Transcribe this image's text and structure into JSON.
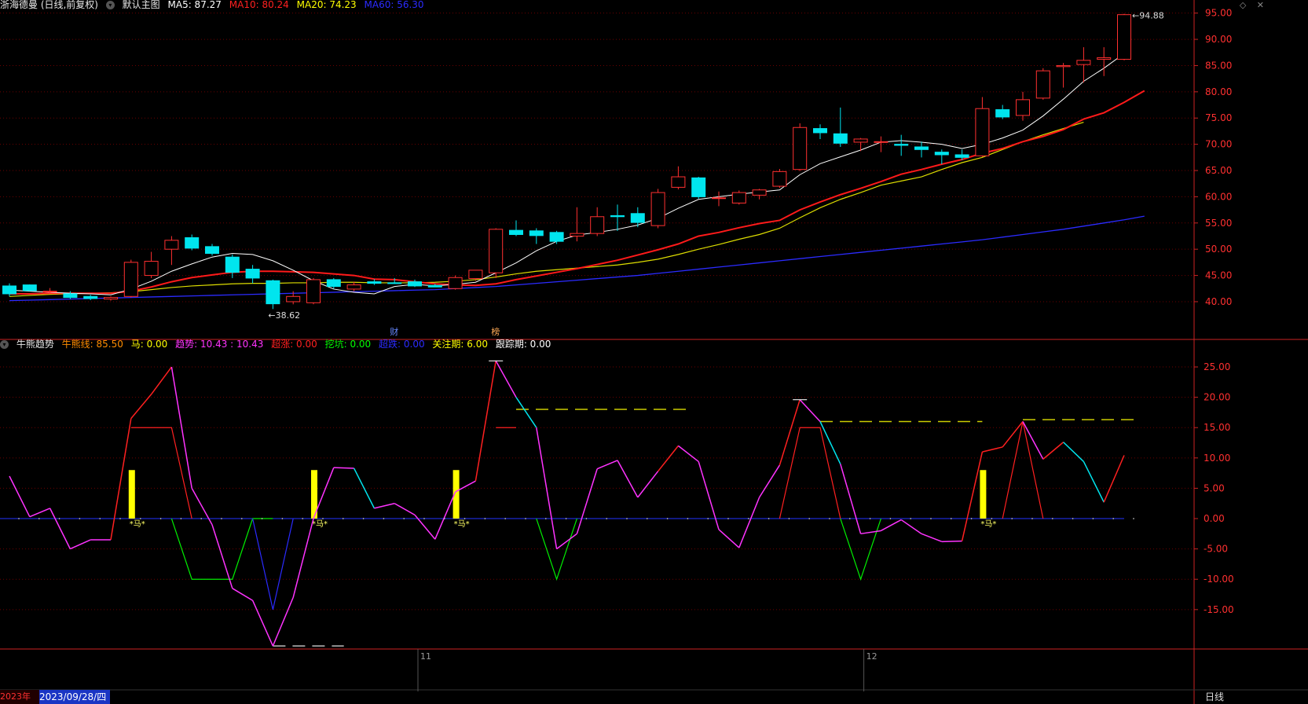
{
  "header": {
    "stock": "浙海德曼 (日线,前复权)",
    "main_chart": "默认主图",
    "ma": [
      {
        "label": "MA5: 87.27",
        "color": "#ffffff"
      },
      {
        "label": "MA10: 80.24",
        "color": "#ff2020"
      },
      {
        "label": "MA20: 74.23",
        "color": "#ffff00"
      },
      {
        "label": "MA60: 56.30",
        "color": "#2b2bff"
      }
    ]
  },
  "sub_header": {
    "name": "牛熊趋势",
    "items": [
      {
        "label": "牛熊线: 85.50",
        "color": "#ff8c00"
      },
      {
        "label": "马: 0.00",
        "color": "#ffff00"
      },
      {
        "label": "趋势: 10.43 : 10.43",
        "color": "#ff33ff"
      },
      {
        "label": "超涨: 0.00",
        "color": "#ff2020"
      },
      {
        "label": "挖坑: 0.00",
        "color": "#00ff00"
      },
      {
        "label": "超跌: 0.00",
        "color": "#2b2bff"
      },
      {
        "label": "关注期: 6.00",
        "color": "#ffff00"
      },
      {
        "label": "跟踪期: 0.00",
        "color": "#ffffff"
      }
    ]
  },
  "footer": {
    "year_label": "2023年",
    "cursor_date": "2023/09/28/四",
    "month_labels": [
      {
        "i": 20,
        "label": "11"
      },
      {
        "i": 42,
        "label": "12"
      }
    ],
    "period": "日线"
  },
  "flags": [
    {
      "i": 19,
      "label": "财",
      "color": "#6688ff"
    },
    {
      "i": 24,
      "label": "榜",
      "color": "#ffaa55"
    }
  ],
  "price_annotations": {
    "high": "94.88",
    "low": "38.62"
  },
  "ma_label_text": "马",
  "colors": {
    "up": "#ff3030",
    "down": "#00e5ee",
    "grid": "#6b0000",
    "axis": "#cc2222"
  },
  "chart_data": {
    "type": "candlestick",
    "price_axis": {
      "ticks": [
        40,
        45,
        50,
        55,
        60,
        65,
        70,
        75,
        80,
        85,
        90,
        95
      ],
      "range": [
        37,
        96
      ]
    },
    "candles": [
      [
        43,
        43.5,
        41,
        41.5
      ],
      [
        43.2,
        43.3,
        42.0,
        42.1
      ],
      [
        42,
        42.6,
        41.5,
        42
      ],
      [
        41.5,
        42,
        40.5,
        40.8
      ],
      [
        41,
        41.3,
        40.3,
        40.6
      ],
      [
        40.5,
        41,
        40.2,
        40.8
      ],
      [
        41,
        48,
        40.8,
        47.5
      ],
      [
        45,
        49.5,
        44.5,
        47.7
      ],
      [
        50,
        52.5,
        47,
        51.7
      ],
      [
        52.2,
        52.8,
        49.8,
        50.2
      ],
      [
        50.5,
        51,
        48.8,
        49.2
      ],
      [
        48.5,
        49,
        44.5,
        45.6
      ],
      [
        46.2,
        47,
        43.5,
        44.5
      ],
      [
        44,
        44.2,
        38.6,
        39.6
      ],
      [
        40,
        42,
        39.5,
        41
      ],
      [
        39.8,
        44.5,
        39.5,
        44.2
      ],
      [
        44.2,
        44.5,
        42.5,
        42.9
      ],
      [
        42.4,
        43.8,
        42,
        43.2
      ],
      [
        43.8,
        44.3,
        43.2,
        43.5
      ],
      [
        43.6,
        44.5,
        43.4,
        43.5
      ],
      [
        43.8,
        44.2,
        42.8,
        43
      ],
      [
        43.1,
        43.4,
        42.8,
        42.8
      ],
      [
        42.5,
        45,
        42.3,
        44.6
      ],
      [
        44.4,
        46,
        44,
        46
      ],
      [
        45.5,
        54,
        44.5,
        53.8
      ],
      [
        53.6,
        55.5,
        52.5,
        52.8
      ],
      [
        53.5,
        54,
        51,
        52.6
      ],
      [
        53.2,
        53.5,
        51,
        51.5
      ],
      [
        52.5,
        58,
        51.5,
        53
      ],
      [
        53,
        58,
        52.5,
        56.2
      ],
      [
        56.4,
        58.5,
        53.5,
        56.2
      ],
      [
        56.8,
        58,
        54.2,
        55.1
      ],
      [
        54.5,
        61.5,
        54,
        60.8
      ],
      [
        61.8,
        65.8,
        61.4,
        63.8
      ],
      [
        63.6,
        63.8,
        59.6,
        60
      ],
      [
        59.8,
        61,
        58.2,
        59.8
      ],
      [
        58.8,
        61.2,
        58.5,
        60.8
      ],
      [
        60.3,
        61.5,
        59.5,
        61.3
      ],
      [
        62,
        65.3,
        61.7,
        64.8
      ],
      [
        65.2,
        74,
        64.9,
        73.2
      ],
      [
        73,
        73.8,
        71,
        72.2
      ],
      [
        72,
        77,
        69.5,
        70.2
      ],
      [
        70.4,
        71.2,
        68.7,
        71
      ],
      [
        70.4,
        71.5,
        68.5,
        70.5
      ],
      [
        70,
        71.8,
        67.8,
        69.8
      ],
      [
        69.5,
        70.5,
        67.5,
        69
      ],
      [
        68.5,
        69,
        66.2,
        68
      ],
      [
        68,
        69,
        67,
        67.5
      ],
      [
        67.8,
        79,
        67.6,
        76.8
      ],
      [
        76.6,
        77.5,
        74.8,
        75.2
      ],
      [
        75.5,
        80,
        74.5,
        78.5
      ],
      [
        78.8,
        84.5,
        78.5,
        84
      ],
      [
        84.8,
        85.5,
        80.8,
        85
      ],
      [
        85.2,
        88.5,
        81.8,
        86
      ],
      [
        86.2,
        88.5,
        83,
        86.5
      ],
      [
        86.2,
        94.88,
        86,
        94.7
      ]
    ],
    "ma5": [
      42.2,
      42.0,
      41.8,
      41.6,
      41.5,
      41.3,
      42.4,
      43.9,
      45.8,
      47.2,
      48.5,
      49.2,
      49.0,
      47.8,
      46.0,
      44.0,
      42.4,
      41.8,
      41.5,
      42.9,
      43.3,
      43.0,
      43.3,
      43.7,
      45.5,
      47.4,
      49.7,
      51.5,
      52.7,
      53.2,
      53.8,
      54.6,
      55.9,
      57.8,
      59.5,
      60.0,
      60.5,
      60.9,
      61.3,
      64.2,
      66.3,
      67.6,
      68.9,
      70.4,
      70.7,
      70.4,
      70.0,
      69.2,
      70.0,
      71.2,
      72.7,
      75.4,
      78.6,
      82.0,
      84.5,
      87.3
    ],
    "ma10": [
      41.5,
      41.5,
      41.6,
      41.6,
      41.6,
      41.6,
      42.0,
      42.8,
      43.8,
      44.6,
      45.1,
      45.6,
      45.8,
      45.8,
      45.7,
      45.6,
      45.3,
      45.0,
      44.3,
      44.2,
      43.8,
      43.4,
      43.2,
      43.1,
      43.4,
      44.2,
      44.9,
      45.6,
      46.3,
      47.1,
      47.9,
      48.9,
      49.9,
      51.0,
      52.5,
      53.2,
      54.1,
      54.9,
      55.5,
      57.5,
      59.0,
      60.4,
      61.6,
      62.9,
      64.3,
      65.2,
      66.2,
      67.1,
      68.3,
      69.2,
      70.5,
      71.5,
      72.8,
      74.8,
      76.0,
      78.0,
      80.2
    ],
    "ma20": [
      41.0,
      41.2,
      41.4,
      41.5,
      41.6,
      41.7,
      41.9,
      42.3,
      42.7,
      43.0,
      43.2,
      43.4,
      43.5,
      43.5,
      43.6,
      43.6,
      43.7,
      43.7,
      43.6,
      43.6,
      43.6,
      43.7,
      43.9,
      44.2,
      44.7,
      45.3,
      45.8,
      46.1,
      46.4,
      46.7,
      47.0,
      47.5,
      48.1,
      49.0,
      50.0,
      50.9,
      51.9,
      52.8,
      54.0,
      56.0,
      57.9,
      59.5,
      60.8,
      62.2,
      63.0,
      63.8,
      65.2,
      66.5,
      67.5,
      69.0,
      70.5,
      71.8,
      73.0,
      74.2
    ],
    "ma60": [
      40.2,
      40.3,
      40.4,
      40.5,
      40.6,
      40.7,
      40.8,
      40.9,
      41.0,
      41.1,
      41.2,
      41.3,
      41.4,
      41.5,
      41.6,
      41.7,
      41.8,
      41.9,
      42.0,
      42.1,
      42.2,
      42.3,
      42.5,
      42.7,
      42.9,
      43.2,
      43.5,
      43.8,
      44.1,
      44.4,
      44.7,
      45.0,
      45.4,
      45.8,
      46.2,
      46.6,
      47.0,
      47.4,
      47.8,
      48.2,
      48.6,
      49.0,
      49.4,
      49.8,
      50.2,
      50.6,
      51.0,
      51.4,
      51.8,
      52.3,
      52.8,
      53.3,
      53.8,
      54.4,
      55.0,
      55.6,
      56.3
    ],
    "indicator_axis": {
      "ticks": [
        -15,
        -10,
        -5,
        0,
        5,
        10,
        15,
        20,
        25
      ],
      "range": [
        -21.5,
        28.5
      ]
    },
    "trend": [
      7,
      0.3,
      1.7,
      -5,
      -3.5,
      -3.5,
      16.5,
      20.5,
      25,
      5,
      -1,
      -11.5,
      -13.5,
      -21,
      -13,
      0,
      8.4,
      8.3,
      1.7,
      2.5,
      0.6,
      -3.4,
      4.4,
      6.2,
      26,
      20,
      15,
      -5,
      -2.5,
      8.2,
      9.6,
      3.5,
      7.8,
      12,
      9.4,
      -1.8,
      -4.8,
      3.5,
      8.8,
      19.6,
      16,
      9,
      -2.5,
      -2,
      -0.2,
      -2.5,
      -3.8,
      -3.7,
      11,
      11.8,
      16,
      9.8,
      12.6,
      9.4,
      2.7,
      10.43
    ],
    "trend_cyan_ranges": [
      [
        17,
        18
      ],
      [
        25,
        26
      ],
      [
        40,
        41
      ],
      [
        52,
        54
      ]
    ],
    "overbought": [
      null,
      null,
      null,
      null,
      null,
      null,
      15,
      15,
      15,
      0,
      null,
      null,
      null,
      null,
      null,
      null,
      null,
      null,
      null,
      null,
      null,
      null,
      null,
      null,
      15,
      15,
      null,
      null,
      null,
      null,
      null,
      null,
      null,
      null,
      null,
      null,
      null,
      null,
      0,
      15,
      15,
      0,
      null,
      null,
      null,
      null,
      null,
      null,
      null,
      0,
      16,
      0,
      null,
      null,
      null,
      null
    ],
    "pit": [
      null,
      null,
      null,
      null,
      null,
      null,
      null,
      null,
      0,
      -10,
      -10,
      -10,
      0,
      0,
      null,
      null,
      null,
      null,
      null,
      null,
      null,
      null,
      null,
      null,
      null,
      null,
      0,
      -10,
      0,
      null,
      null,
      null,
      null,
      null,
      null,
      null,
      null,
      null,
      null,
      null,
      null,
      0,
      -10,
      0,
      null,
      null,
      null,
      null,
      null,
      null,
      null,
      null,
      null,
      null,
      null,
      null
    ],
    "oversold": [
      null,
      null,
      null,
      null,
      null,
      null,
      null,
      null,
      null,
      null,
      null,
      null,
      0,
      -15,
      0,
      null,
      null,
      null,
      null,
      null,
      null,
      null,
      null,
      null,
      null,
      null,
      null,
      null,
      null,
      null,
      null,
      null,
      null,
      null,
      null,
      null,
      null,
      null,
      null,
      null,
      null,
      null,
      null,
      null,
      null,
      null,
      null,
      null,
      null,
      null,
      null,
      null,
      null,
      null,
      null,
      null
    ],
    "horse_bars": [
      {
        "i": 6,
        "value": 8
      },
      {
        "i": 15,
        "value": 8
      },
      {
        "i": 22,
        "value": 8
      },
      {
        "i": 48,
        "value": 8
      }
    ],
    "dashed_levels": [
      {
        "from": 25,
        "to": 33.5,
        "value": 18,
        "color": "#cccc00"
      },
      {
        "from": 40,
        "to": 48,
        "value": 16,
        "color": "#cccc00"
      },
      {
        "from": 50,
        "to": 55.5,
        "value": 16.3,
        "color": "#cccc00"
      },
      {
        "from": 13,
        "to": 16.5,
        "value": -21,
        "color": "#bbbbbb"
      }
    ],
    "peak_marks": [
      {
        "i": 24,
        "value": 26
      },
      {
        "i": 39,
        "value": 19.6
      }
    ],
    "zero_line_color": "#2233ff"
  }
}
